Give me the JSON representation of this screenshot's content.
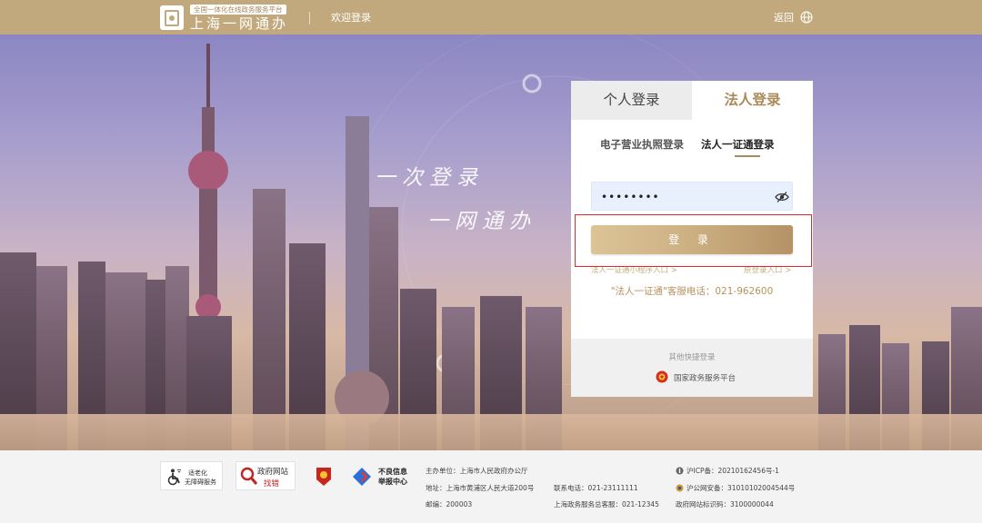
{
  "header": {
    "brand_tag": "全国一体化在线政务服务平台",
    "brand_title": "上海一网通办",
    "welcome": "欢迎登录",
    "back": "返回",
    "lang_icon": "globe-icon"
  },
  "hero": {
    "slogan_line1": "一次登录",
    "slogan_line2": "一网通办"
  },
  "login": {
    "tabs": [
      {
        "label": "个人登录",
        "active": false
      },
      {
        "label": "法人登录",
        "active": true
      }
    ],
    "subtabs": [
      {
        "label": "电子营业执照登录",
        "active": false
      },
      {
        "label": "法人一证通登录",
        "active": true
      }
    ],
    "password_value": "••••••••",
    "login_button": "登 录",
    "link_left": "法人一证通小程序入口 >",
    "link_right": "原登录入口 >",
    "service_tel": "\"法人一证通\"客服电话：021-962600",
    "quick_title": "其他快捷登录",
    "quick_gov": "国家政务服务平台"
  },
  "footer": {
    "elder_line1": "适老化",
    "elder_line2": "无障碍服务",
    "gov_site_line1": "政府网站",
    "gov_site_line2": "找错",
    "report_line1": "不良信息",
    "report_line2": "举报中心",
    "sponsor": "主办单位：上海市人民政府办公厅",
    "address": "地址：上海市黄浦区人民大道200号",
    "postcode": "邮编：200003",
    "contact_tel": "联系电话：021-23111111",
    "hotline": "上海政务服务总客服：021-12345",
    "icp": "沪ICP备：20210162456号-1",
    "police": "沪公网安备：31010102004544号",
    "site_code": "政府网站标识码：3100000044"
  },
  "colors": {
    "header_gold": "#c2a97d",
    "accent_gold": "#a98a58",
    "highlight_red": "#e02a2a"
  }
}
